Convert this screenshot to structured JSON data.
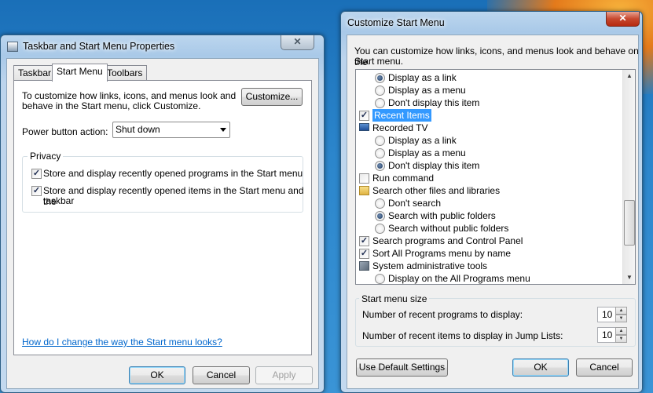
{
  "left_window": {
    "title": "Taskbar and Start Menu Properties",
    "tabs": [
      {
        "label": "Taskbar"
      },
      {
        "label": "Start Menu"
      },
      {
        "label": "Toolbars"
      }
    ],
    "active_tab": "Start Menu",
    "description_line1": "To customize how links, icons, and menus look and",
    "description_line2": "behave in the Start menu, click Customize.",
    "customize_button": "Customize...",
    "power_label": "Power button action:",
    "power_value": "Shut down",
    "privacy_group": "Privacy",
    "privacy_check1": "Store and display recently opened programs in the Start menu",
    "privacy_check2_line1": "Store and display recently opened items in the Start menu and the",
    "privacy_check2_line2": "taskbar",
    "help_link": "How do I change the way the Start menu looks?",
    "ok": "OK",
    "cancel": "Cancel",
    "apply": "Apply",
    "close_glyph": "✕"
  },
  "right_window": {
    "title": "Customize Start Menu",
    "description_line1": "You can customize how links, icons, and menus look and behave on the",
    "description_line2": "Start menu.",
    "tree": [
      {
        "type": "radio",
        "label": "Display as a link",
        "checked": true
      },
      {
        "type": "radio",
        "label": "Display as a menu",
        "checked": false
      },
      {
        "type": "radio",
        "label": "Don't display this item",
        "checked": false
      },
      {
        "type": "checkbox",
        "label": "Recent Items",
        "checked": true,
        "selected": true
      },
      {
        "type": "icon",
        "label": "Recorded TV",
        "icon": "monitor-icon"
      },
      {
        "type": "radio",
        "label": "Display as a link",
        "checked": false
      },
      {
        "type": "radio",
        "label": "Display as a menu",
        "checked": false
      },
      {
        "type": "radio",
        "label": "Don't display this item",
        "checked": true
      },
      {
        "type": "checkbox",
        "label": "Run command",
        "checked": false
      },
      {
        "type": "icon",
        "label": "Search other files and libraries",
        "icon": "folder-icon"
      },
      {
        "type": "radio",
        "label": "Don't search",
        "checked": false
      },
      {
        "type": "radio",
        "label": "Search with public folders",
        "checked": true
      },
      {
        "type": "radio",
        "label": "Search without public folders",
        "checked": false
      },
      {
        "type": "checkbox",
        "label": "Search programs and Control Panel",
        "checked": true
      },
      {
        "type": "checkbox",
        "label": "Sort All Programs menu by name",
        "checked": true
      },
      {
        "type": "icon",
        "label": "System administrative tools",
        "icon": "admin-tools-icon"
      },
      {
        "type": "radio",
        "label": "Display on the All Programs menu",
        "checked": false
      }
    ],
    "size_group": "Start menu size",
    "recent_programs_label": "Number of recent programs to display:",
    "recent_programs_value": "10",
    "recent_items_label": "Number of recent items to display in Jump Lists:",
    "recent_items_value": "10",
    "default_button": "Use Default Settings",
    "ok": "OK",
    "cancel": "Cancel",
    "close_glyph": "✕"
  },
  "glyphs": {
    "check": "✓",
    "scroll_up": "▲",
    "scroll_down": "▼"
  }
}
